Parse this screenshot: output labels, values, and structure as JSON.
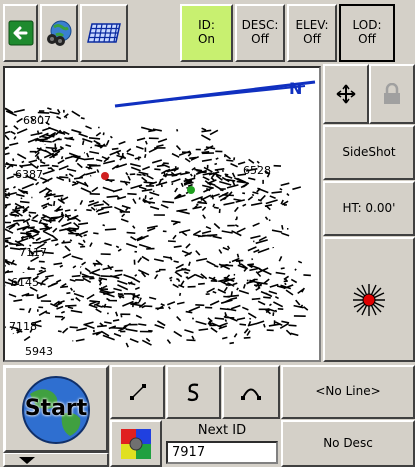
{
  "toolbar": {
    "back_icon": "back-arrow-icon",
    "gps_icon": "binoculars-globe-icon",
    "grid_icon": "grid-icon",
    "id_label": "ID:",
    "id_value": "On",
    "desc_label": "DESC:",
    "desc_value": "Off",
    "elev_label": "ELEV:",
    "elev_value": "Off",
    "lod_label": "LOD:",
    "lod_value": "Off"
  },
  "map": {
    "north_label": "N",
    "point_labels": [
      "6807",
      "6387",
      "6528",
      "7117",
      "6145",
      "5943",
      "7118"
    ]
  },
  "side_panel": {
    "zoom_icon": "zoom-extents-icon",
    "lock_icon": "lock-icon",
    "sideshot_label": "SideShot",
    "ht_label": "HT: 0.00'",
    "target_icon": "crosshair-target-icon"
  },
  "bottom": {
    "start_label": "Start",
    "line_btn_icon": "line-segment-icon",
    "curve_btn_icon": "s-curve-icon",
    "arc_btn_icon": "arc-icon",
    "no_line_label": "<No Line>",
    "color_icon": "color-picker-icon",
    "next_id_label": "Next ID",
    "next_id_value": "7917",
    "no_desc_label": "No Desc",
    "dropdown_icon": "dropdown-arrow-icon"
  },
  "colors": {
    "toolbar_on": "#c8f070",
    "back_green": "#1e8a2e",
    "north_blue": "#1030c0",
    "point_red": "#d02020",
    "point_green": "#20a020"
  }
}
